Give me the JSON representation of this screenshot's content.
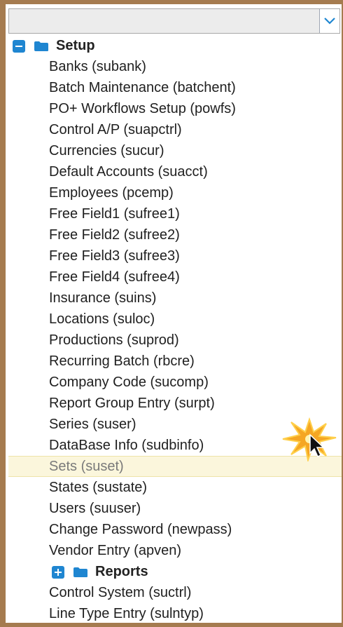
{
  "combo": {
    "value": "",
    "dropdown_icon": "chevron-down-icon"
  },
  "tree": {
    "setup": {
      "label": "Setup",
      "expanded": true,
      "toggle_icon": "minus-box-icon",
      "folder_icon": "folder-icon",
      "items": [
        "Banks (subank)",
        "Batch Maintenance (batchent)",
        "PO+ Workflows Setup (powfs)",
        "Control A/P (suapctrl)",
        "Currencies (sucur)",
        "Default Accounts (suacct)",
        "Employees (pcemp)",
        "Free Field1 (sufree1)",
        "Free Field2 (sufree2)",
        "Free Field3 (sufree3)",
        "Free Field4 (sufree4)",
        "Insurance (suins)",
        "Locations (suloc)",
        "Productions (suprod)",
        "Recurring Batch (rbcre)",
        "Company Code (sucomp)",
        "Report Group Entry (surpt)",
        "Series (suser)",
        "DataBase Info (sudbinfo)",
        "Sets (suset)",
        "States (sustate)",
        "Users (suuser)",
        "Change Password (newpass)",
        "Vendor Entry (apven)"
      ],
      "selected_index": 19
    },
    "reports": {
      "label": "Reports",
      "expanded": false,
      "toggle_icon": "plus-box-icon",
      "folder_icon": "folder-icon"
    },
    "after_items": [
      "Control System (suctrl)",
      "Line Type Entry (sulntyp)"
    ]
  },
  "overlay": {
    "click_effect_icon": "click-burst-icon",
    "cursor_icon": "mouse-cursor-icon"
  },
  "colors": {
    "frame": "#a57b4f",
    "accent": "#1f86d1",
    "selected_row_bg": "#fbf6dc",
    "selected_text": "#7a7a7a",
    "burst": "#f5a623"
  }
}
